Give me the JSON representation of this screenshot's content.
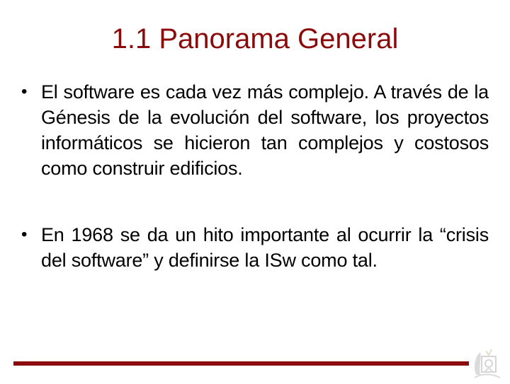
{
  "slide": {
    "title": "1.1 Panorama General",
    "bullets": [
      {
        "marker": "•",
        "text": "El software es cada vez más complejo. A través de la Génesis de la evolución del software, los proyectos informáticos se hicieron tan complejos y costosos como construir edificios."
      },
      {
        "marker": "•",
        "text": "En 1968 se da un hito importante al ocurrir la “crisis del software” y definirse la ISw como tal."
      }
    ],
    "footer": {
      "logo_icon": "institution-crest-icon"
    }
  },
  "colors": {
    "title": "#8b0a0a",
    "footer_bar": "#8b0a0a",
    "text": "#000000",
    "background": "#ffffff"
  }
}
